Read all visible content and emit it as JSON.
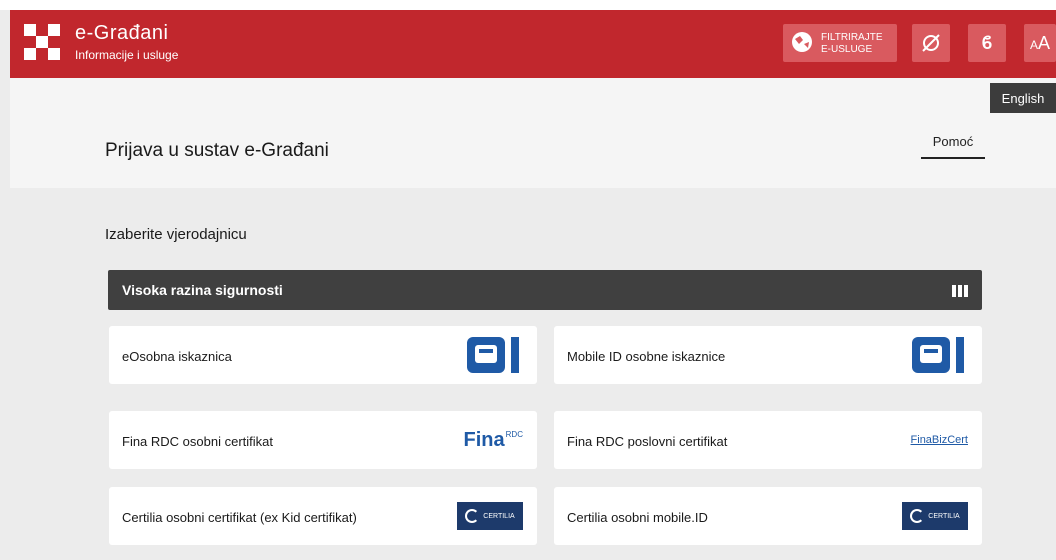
{
  "header": {
    "brand_title": "e-Građani",
    "brand_subtitle": "Informacije i usluge",
    "filter_label_line1": "FILTRIRAJTE",
    "filter_label_line2": "E-USLUGE",
    "font_toggle_label": "ϐ",
    "font_size_label": "AA"
  },
  "language": {
    "english": "English"
  },
  "page": {
    "title": "Prijava u sustav e-Građani",
    "help": "Pomoć",
    "section_label": "Izaberite vjerodajnicu"
  },
  "security_level": {
    "label": "Visoka razina sigurnosti"
  },
  "credentials": [
    {
      "name": "eOsobna iskaznica",
      "logo": "eoi-logo"
    },
    {
      "name": "Mobile ID osobne iskaznice",
      "logo": "eoi-logo"
    },
    {
      "name": "Fina RDC osobni certifikat",
      "logo": "fina-rdc-logo"
    },
    {
      "name": "Fina RDC poslovni certifikat",
      "logo": "fina-bizcert-logo"
    },
    {
      "name": "Certilia osobni certifikat (ex Kid certifikat)",
      "logo": "certilia-logo"
    },
    {
      "name": "Certilia osobni mobile.ID",
      "logo": "certilia-logo"
    }
  ],
  "logo_text": {
    "fina": "Fina",
    "rdc": "RDC",
    "fina_biz": "FinaBizCert",
    "certilia": "CERTILIA"
  },
  "colors": {
    "header_red": "#c1272d",
    "button_red": "#d95a5f",
    "dark_bar": "#404040",
    "eoi_blue": "#1f5aa6"
  }
}
